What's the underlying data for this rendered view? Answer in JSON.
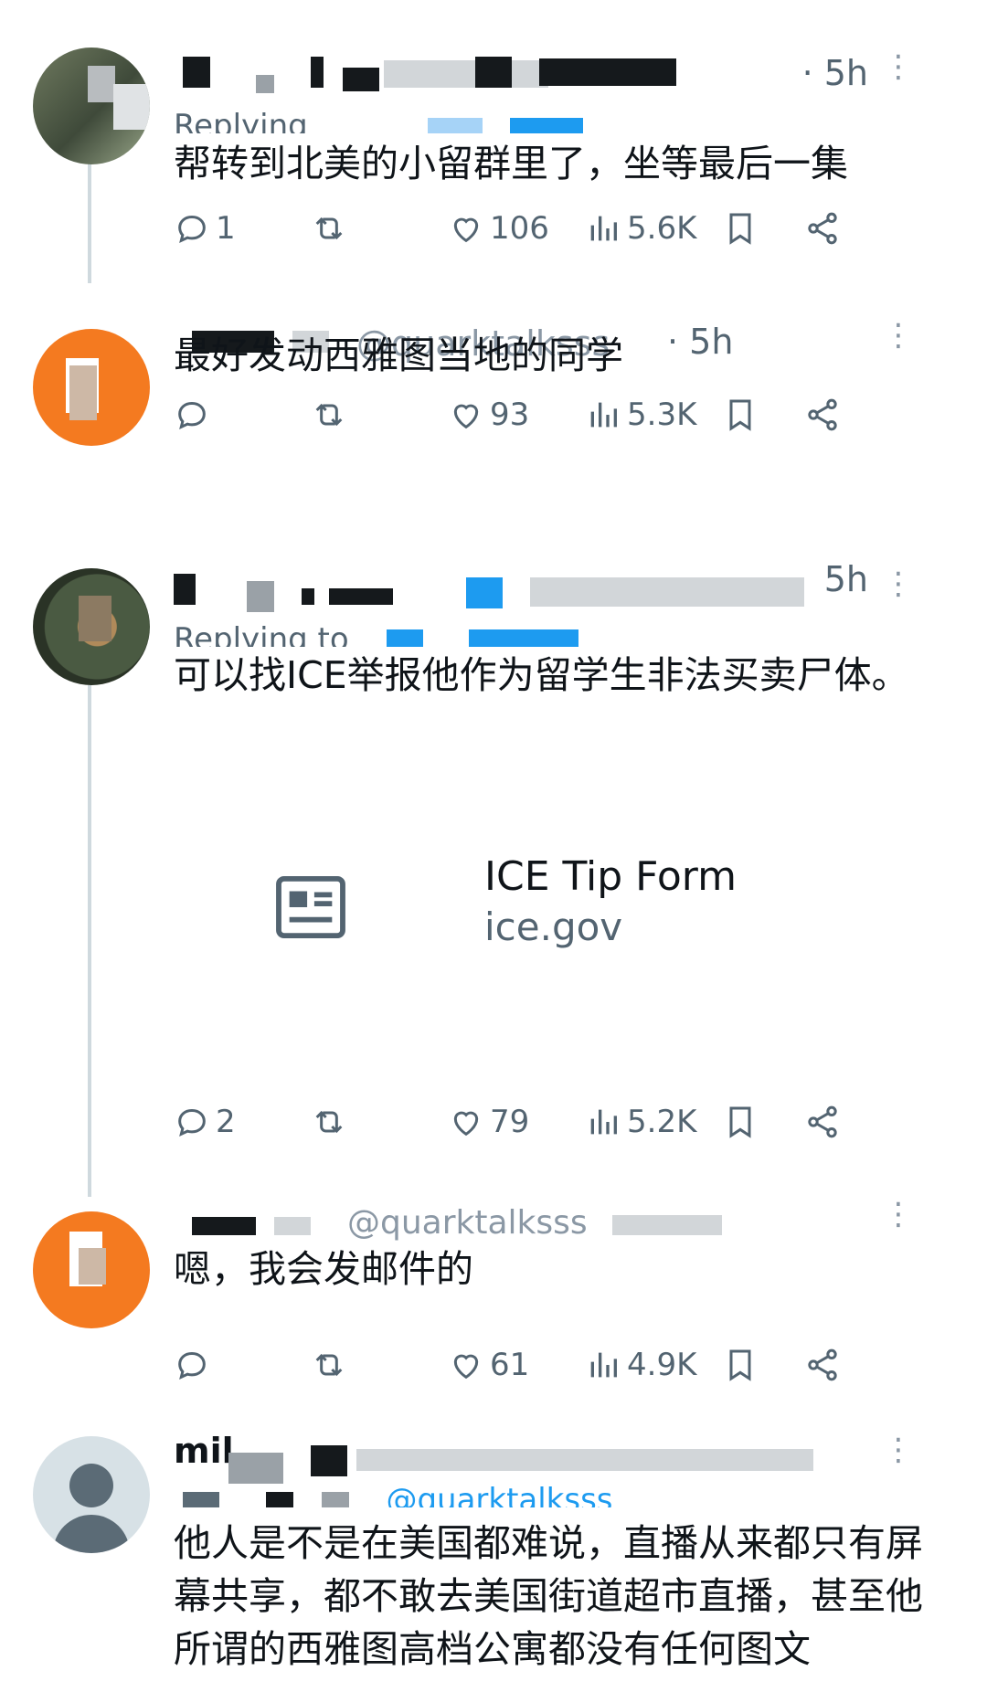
{
  "tweets": [
    {
      "time": "· 5h",
      "replying_prefix": "Replying",
      "text": "帮转到北美的小留群里了，坐等最后一集",
      "stats": {
        "replies": "1",
        "retweets": "",
        "likes": "106",
        "views": "5.6K"
      }
    },
    {
      "handle_fragment": "@quarktalksss",
      "time": "· 5h",
      "text": "最好发动西雅图当地的同学",
      "stats": {
        "replies": "",
        "retweets": "",
        "likes": "93",
        "views": "5.3K"
      }
    },
    {
      "time": "5h",
      "replying_prefix": "Replying to",
      "text": "可以找ICE举报他作为留学生非法买卖尸体。",
      "card": {
        "title": "ICE Tip Form",
        "domain": "ice.gov"
      },
      "stats": {
        "replies": "2",
        "retweets": "",
        "likes": "79",
        "views": "5.2K"
      }
    },
    {
      "handle_fragment": "@quarktalksss",
      "text": "嗯，我会发邮件的",
      "stats": {
        "replies": "",
        "retweets": "",
        "likes": "61",
        "views": "4.9K"
      }
    },
    {
      "name_fragment": "mil",
      "handle_fragment": "@quarktalksss",
      "text": "他人是不是在美国都难说，直播从来都只有屏幕共享，都不敢去美国街道超市直播，甚至他所谓的西雅图高档公寓都没有任何图文"
    }
  ],
  "icons": [
    "reply-icon",
    "retweet-icon",
    "like-icon",
    "views-icon",
    "bookmark-icon",
    "share-icon",
    "more-icon",
    "article-icon"
  ],
  "colors": {
    "text": "#0f1419",
    "secondary": "#536471",
    "accent": "#1d9bf0",
    "line": "#cfd9de"
  }
}
